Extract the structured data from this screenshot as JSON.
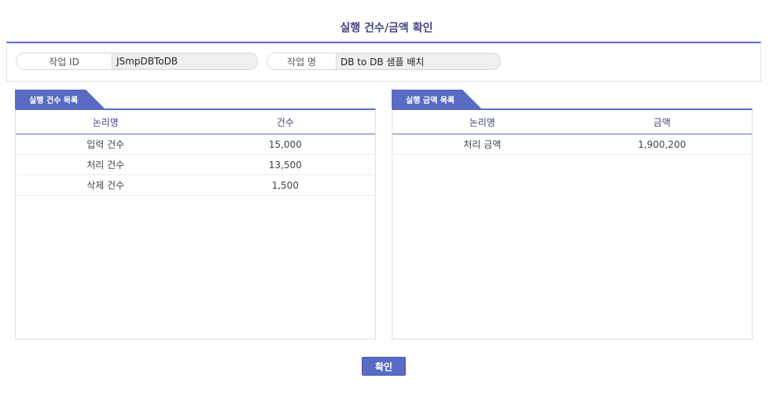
{
  "dialog": {
    "title": "실행 건수/금액 확인",
    "confirm_label": "확인"
  },
  "info": {
    "job_id_label": "작업 ID",
    "job_id_value": "JSmpDBToDB",
    "job_name_label": "작업 명",
    "job_name_value": "DB to DB 샘플 배치"
  },
  "count_panel": {
    "tab_label": "실행 건수 목록",
    "headers": [
      "논리명",
      "건수"
    ],
    "rows": [
      [
        "입력 건수",
        "15,000"
      ],
      [
        "처리 건수",
        "13,500"
      ],
      [
        "삭제 건수",
        "1,500"
      ]
    ]
  },
  "amount_panel": {
    "tab_label": "실행 금액 목록",
    "headers": [
      "논리명",
      "금액"
    ],
    "rows": [
      [
        "처리 금액",
        "1,900,200"
      ]
    ]
  },
  "colors": {
    "accent": "#5a6bc4",
    "title": "#44467e"
  }
}
